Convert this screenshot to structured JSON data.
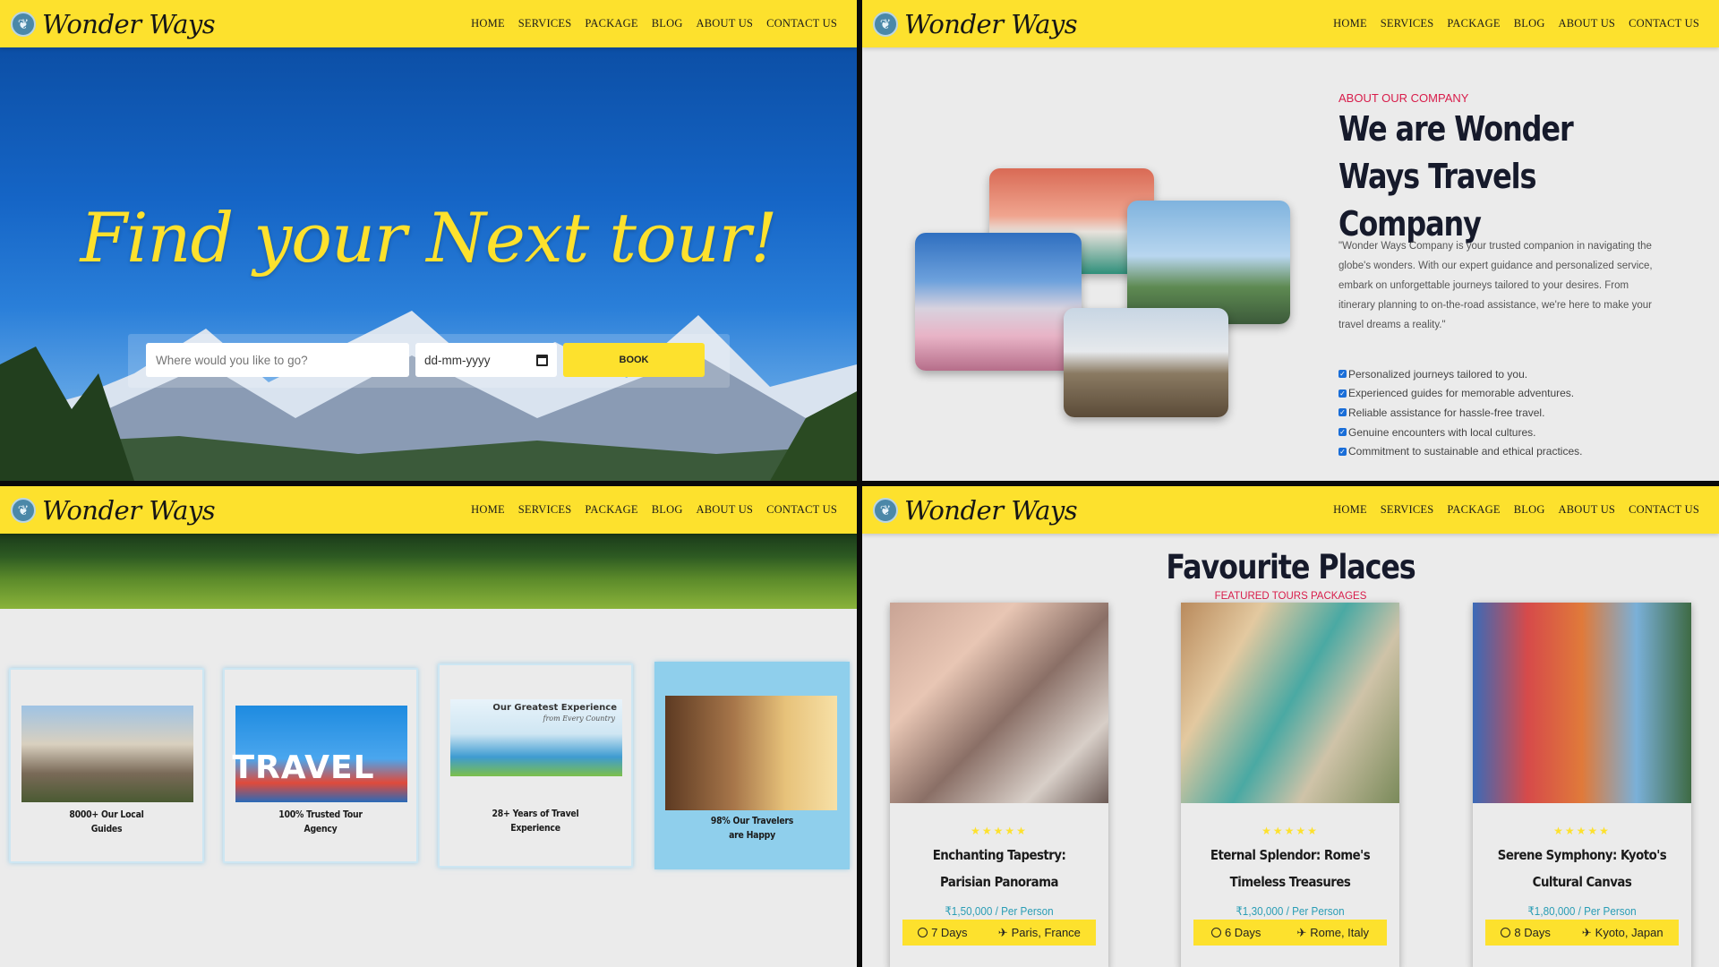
{
  "brand": {
    "name": "Wonder Ways",
    "logo_icon": "globe-leaf-icon"
  },
  "nav": [
    "HOME",
    "SERVICES",
    "PACKAGE",
    "BLOG",
    "ABOUT US",
    "CONTACT US"
  ],
  "hero": {
    "title": "Find your Next tour!",
    "destination_placeholder": "Where would you like to go?",
    "date_placeholder": "dd-mm-yyyy",
    "book_label": "BOOK"
  },
  "about": {
    "kicker": "ABOUT OUR COMPANY",
    "title": "We are Wonder Ways Travels Company",
    "paragraph": "\"Wonder Ways Company is your trusted companion in navigating the globe's wonders. With our expert guidance and personalized service, embark on unforgettable journeys tailored to your desires. From itinerary planning to on-the-road assistance, we're here to make your travel dreams a reality.\"",
    "points": [
      "Personalized journeys tailored to you.",
      "Experienced guides for memorable adventures.",
      "Reliable assistance for hassle-free travel.",
      "Genuine encounters with local cultures.",
      "Commitment to sustainable and ethical practices."
    ]
  },
  "stats": [
    {
      "caption": "8000+ Our Local Guides",
      "line1": "8000+ Our Local",
      "line2": "Guides"
    },
    {
      "caption": "100% Trusted Tour Agency",
      "line1": "100% Trusted Tour",
      "line2": "Agency",
      "img_text": "TRAVEL"
    },
    {
      "caption": "28+ Years of Travel Experience",
      "line1": "28+ Years of Travel",
      "line2": "Experience",
      "img_text": "Our Greatest Experience",
      "img_sub": "from Every Country"
    },
    {
      "caption": "98% Our Travelers are Happy",
      "line1": "98% Our Travelers",
      "line2": "are Happy"
    }
  ],
  "places": {
    "title": "Favourite Places",
    "subtitle": "FEATURED TOURS PACKAGES",
    "rating": "★★★★★",
    "items": [
      {
        "title": "Enchanting Tapestry: Parisian Panorama",
        "price": "₹1,50,000 / Per Person",
        "days": "7 Days",
        "location": "Paris, France"
      },
      {
        "title": "Eternal Splendor: Rome's Timeless Treasures",
        "price": "₹1,30,000 / Per Person",
        "days": "6 Days",
        "location": "Rome, Italy"
      },
      {
        "title": "Serene Symphony: Kyoto's Cultural Canvas",
        "price": "₹1,80,000 / Per Person",
        "days": "8 Days",
        "location": "Kyoto, Japan"
      }
    ]
  },
  "colors": {
    "nav_yellow": "#fde12d",
    "accent_red": "#d81c4a",
    "price_teal": "#2a9db5",
    "active_card": "#8fcfec"
  }
}
